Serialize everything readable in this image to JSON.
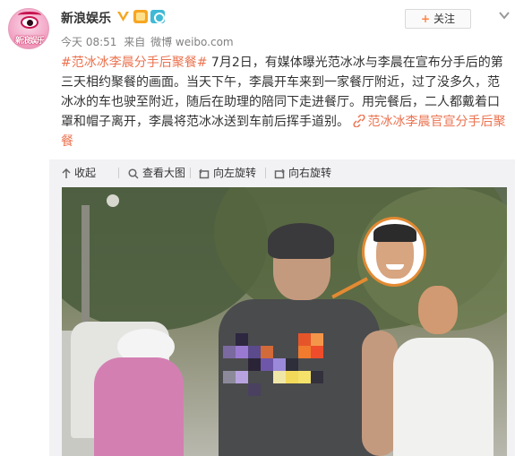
{
  "post": {
    "author": "新浪娱乐",
    "avatar_text": "新浪娱乐",
    "meta": {
      "time": "今天 08:51",
      "from_label": "来自",
      "source": "微博 weibo.com"
    },
    "follow_label": "关注",
    "text": {
      "topic1": "#范冰冰李晨分手后聚餐#",
      "body": " 7月2日，有媒体曝光范冰冰与李晨在宣布分手后的第三天相约聚餐的画面。当天下午，李晨开车来到一家餐厅附近，过了没多久，范冰冰的车也驶至附近，随后在助理的陪同下走进餐厅。用完餐后，二人都戴着口罩和帽子离开，李晨将范冰冰送到车前后挥手道别。 ",
      "link_text": "范冰冰李晨官宣分手后聚餐"
    }
  },
  "media_toolbar": {
    "collapse": "收起",
    "view_large": "查看大图",
    "rotate_left": "向左旋转",
    "rotate_right": "向右旋转"
  },
  "colors": {
    "accent_link": "#eb7350",
    "meta_text": "#808080",
    "verified": "#f6a623"
  },
  "icons": [
    "up-arrow-icon",
    "magnify-icon",
    "rotate-left-icon",
    "rotate-right-icon",
    "chevron-down-icon",
    "verified-icon",
    "link-icon"
  ]
}
